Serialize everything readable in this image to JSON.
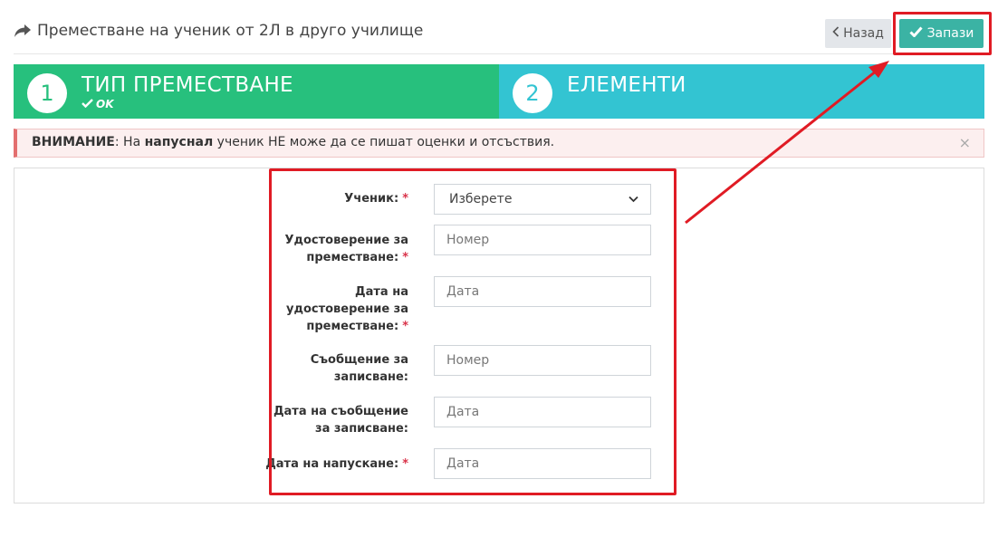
{
  "header": {
    "title": "Преместване на ученик от 2Л в друго училище",
    "title_icon": "share-arrow-icon",
    "back_label": "Назад",
    "save_label": "Запази"
  },
  "steps": [
    {
      "number": "1",
      "title": "ТИП ПРЕМЕСТВАНЕ",
      "status": "OK",
      "status_icon": "check-icon",
      "color": "#27c07d"
    },
    {
      "number": "2",
      "title": "ЕЛЕМЕНТИ",
      "color": "#33c4d2"
    }
  ],
  "alert": {
    "prefix": "ВНИМАНИЕ",
    "part1": ": На ",
    "emphasis": "напуснал",
    "part2": " ученик НЕ може да се пишат оценки и отсъствия.",
    "close": "×"
  },
  "form": {
    "fields": [
      {
        "label": "Ученик:",
        "required": true,
        "type": "select",
        "value": "Изберете"
      },
      {
        "label_lines": [
          "Удостоверение за",
          "преместване:"
        ],
        "required": true,
        "type": "text",
        "placeholder": "Номер"
      },
      {
        "label_lines": [
          "Дата на",
          "удостоверение за",
          "преместване:"
        ],
        "required": true,
        "type": "text",
        "placeholder": "Дата"
      },
      {
        "label_lines": [
          "Съобщение за",
          "записване:"
        ],
        "required": false,
        "type": "text",
        "placeholder": "Номер"
      },
      {
        "label_lines": [
          "Дата на съобщение",
          "за записване:"
        ],
        "required": false,
        "type": "text",
        "placeholder": "Дата"
      },
      {
        "label": "Дата на напускане:",
        "required": true,
        "type": "text",
        "placeholder": "Дата"
      }
    ],
    "required_mark": "*"
  },
  "colors": {
    "accent": "#3bb3a4",
    "highlight": "#e01b24",
    "step1": "#27c07d",
    "step2": "#33c4d2"
  }
}
